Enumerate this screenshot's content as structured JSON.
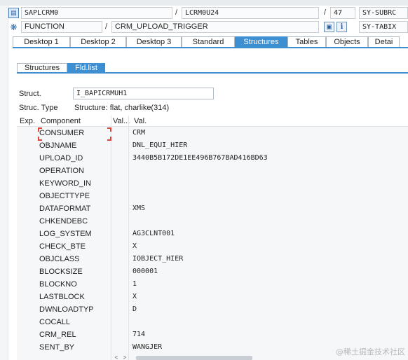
{
  "header": {
    "row1": {
      "program": "SAPLCRM0",
      "include": "LCRM0U24",
      "line": "47",
      "sysvar": "SY-SUBRC"
    },
    "row2": {
      "type": "FUNCTION",
      "name": "CRM_UPLOAD_TRIGGER",
      "sysvar": "SY-TABIX"
    },
    "icons": {
      "program": "program-icon",
      "function": "function-module-icon",
      "display": "display-object-icon",
      "info": "info-icon"
    }
  },
  "tabs": [
    "Desktop 1",
    "Desktop 2",
    "Desktop 3",
    "Standard",
    "Structures",
    "Tables",
    "Objects",
    "Detai"
  ],
  "active_tab": "Structures",
  "subtabs": [
    "Structures",
    "Fld.list"
  ],
  "active_subtab": "Fld.list",
  "struct": {
    "label": "Struct.",
    "value": "I_BAPICRMUH1",
    "type_label": "Struc. Type",
    "type_value": "Structure: flat, charlike(314)"
  },
  "grid": {
    "headers": {
      "exp": "Exp.",
      "component": "Component",
      "valdots": "Val...",
      "val": "Val."
    },
    "rows": [
      {
        "component": "CONSUMER",
        "value": "CRM"
      },
      {
        "component": "OBJNAME",
        "value": "DNL_EQUI_HIER"
      },
      {
        "component": "UPLOAD_ID",
        "value": "3440B5B172DE1EE496B767BAD416BD63"
      },
      {
        "component": "OPERATION",
        "value": ""
      },
      {
        "component": "KEYWORD_IN",
        "value": ""
      },
      {
        "component": "OBJECTTYPE",
        "value": ""
      },
      {
        "component": "DATAFORMAT",
        "value": "XMS"
      },
      {
        "component": "CHKENDEBC",
        "value": ""
      },
      {
        "component": "LOG_SYSTEM",
        "value": "AG3CLNT001"
      },
      {
        "component": "CHECK_BTE",
        "value": "X"
      },
      {
        "component": "OBJCLASS",
        "value": "IOBJECT_HIER"
      },
      {
        "component": "BLOCKSIZE",
        "value": "000001"
      },
      {
        "component": "BLOCKNO",
        "value": "1"
      },
      {
        "component": "LASTBLOCK",
        "value": "X"
      },
      {
        "component": "DWNLOADTYP",
        "value": "D"
      },
      {
        "component": "COCALL",
        "value": ""
      },
      {
        "component": "CRM_REL",
        "value": "714"
      },
      {
        "component": "SENT_BY",
        "value": "WANGJER"
      }
    ]
  },
  "scroll": {
    "left_arrow": "<",
    "right_arrow": ">"
  },
  "watermark": "@稀土掘金技术社区",
  "colors": {
    "accent": "#3d8fd1",
    "highlight": "#e0443a"
  }
}
